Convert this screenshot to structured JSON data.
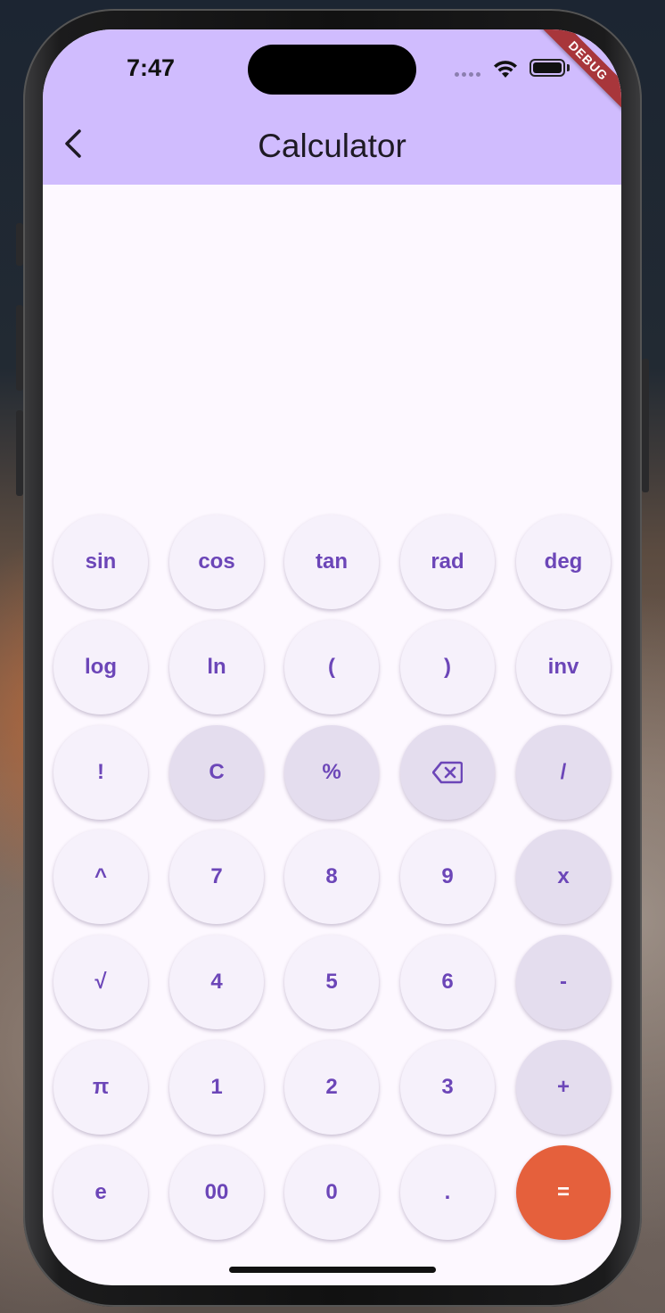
{
  "status_bar": {
    "time": "7:47",
    "wifi_icon": "wifi-icon",
    "battery_icon": "battery-icon"
  },
  "debug_banner": "DEBUG",
  "app_bar": {
    "title": "Calculator",
    "back_icon": "chevron-left-icon",
    "background": "#d0bcfe"
  },
  "display": {
    "expression": "",
    "result": ""
  },
  "colors": {
    "key_light": "#f6f1fb",
    "key_dark": "#e4ddee",
    "key_text": "#6c46b8",
    "equals": "#e5603c",
    "screen_bg": "#fdf8ff"
  },
  "keypad": {
    "rows": [
      [
        {
          "label": "sin",
          "style": "light"
        },
        {
          "label": "cos",
          "style": "light"
        },
        {
          "label": "tan",
          "style": "light"
        },
        {
          "label": "rad",
          "style": "light"
        },
        {
          "label": "deg",
          "style": "light"
        }
      ],
      [
        {
          "label": "log",
          "style": "light"
        },
        {
          "label": "ln",
          "style": "light"
        },
        {
          "label": "(",
          "style": "light"
        },
        {
          "label": ")",
          "style": "light"
        },
        {
          "label": "inv",
          "style": "light"
        }
      ],
      [
        {
          "label": "!",
          "style": "light"
        },
        {
          "label": "C",
          "style": "dark"
        },
        {
          "label": "%",
          "style": "dark"
        },
        {
          "label": "",
          "icon": "backspace-icon",
          "style": "dark"
        },
        {
          "label": "/",
          "style": "dark"
        }
      ],
      [
        {
          "label": "^",
          "style": "light"
        },
        {
          "label": "7",
          "style": "light"
        },
        {
          "label": "8",
          "style": "light"
        },
        {
          "label": "9",
          "style": "light"
        },
        {
          "label": "x",
          "style": "dark"
        }
      ],
      [
        {
          "label": "√",
          "style": "light"
        },
        {
          "label": "4",
          "style": "light"
        },
        {
          "label": "5",
          "style": "light"
        },
        {
          "label": "6",
          "style": "light"
        },
        {
          "label": "-",
          "style": "dark"
        }
      ],
      [
        {
          "label": "π",
          "style": "light"
        },
        {
          "label": "1",
          "style": "light"
        },
        {
          "label": "2",
          "style": "light"
        },
        {
          "label": "3",
          "style": "light"
        },
        {
          "label": "+",
          "style": "dark"
        }
      ],
      [
        {
          "label": "e",
          "style": "light"
        },
        {
          "label": "00",
          "style": "light"
        },
        {
          "label": "0",
          "style": "light"
        },
        {
          "label": ".",
          "style": "light"
        },
        {
          "label": "=",
          "style": "accent"
        }
      ]
    ]
  }
}
